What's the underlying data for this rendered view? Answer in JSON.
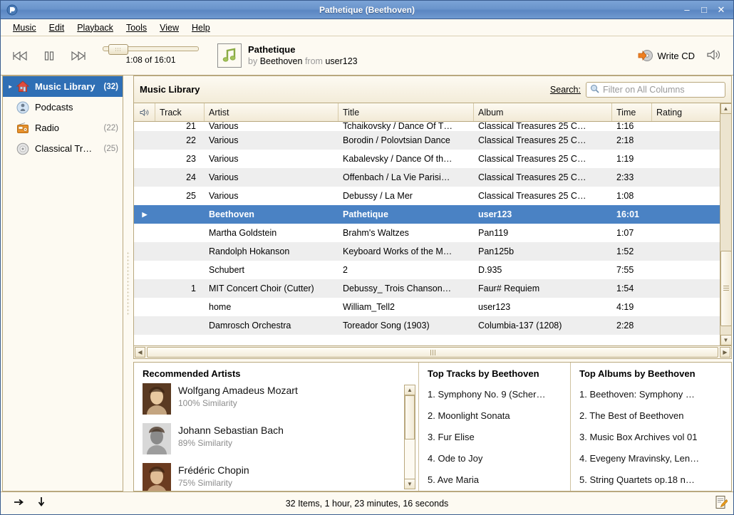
{
  "window": {
    "title": "Pathetique (Beethoven)",
    "app_icon": "rhythmbox-icon",
    "buttons": {
      "minimize": "–",
      "maximize": "□",
      "close": "✕"
    }
  },
  "menubar": {
    "items": [
      {
        "label": "Music",
        "mnemonic": "M"
      },
      {
        "label": "Edit",
        "mnemonic": "E"
      },
      {
        "label": "Playback",
        "mnemonic": "P"
      },
      {
        "label": "Tools",
        "mnemonic": "T"
      },
      {
        "label": "View",
        "mnemonic": "V"
      },
      {
        "label": "Help",
        "mnemonic": "H"
      }
    ]
  },
  "toolbar": {
    "previous_label": "Previous",
    "pause_label": "Pause",
    "next_label": "Next",
    "seek_time": "1:08 of 16:01",
    "seek_position_percent": 7,
    "now_playing": {
      "title": "Pathetique",
      "by_word": "by",
      "artist": "Beethoven",
      "from_word": "from",
      "album": "user123"
    },
    "write_cd_label": "Write CD",
    "volume_label": "Volume"
  },
  "sidebar": {
    "items": [
      {
        "label": "Music Library",
        "count": "(32)",
        "icon": "home-icon",
        "selected": true,
        "expander": "▸"
      },
      {
        "label": "Podcasts",
        "count": "",
        "icon": "podcast-icon",
        "selected": false,
        "expander": ""
      },
      {
        "label": "Radio",
        "count": "(22)",
        "icon": "radio-icon",
        "selected": false,
        "expander": ""
      },
      {
        "label": "Classical Tr…",
        "count": "(25)",
        "icon": "cd-icon",
        "selected": false,
        "expander": ""
      }
    ]
  },
  "library": {
    "header_title": "Music Library",
    "search": {
      "label": "Search:",
      "mnemonic": "S",
      "value": "",
      "placeholder": "Filter on All Columns",
      "icon": "search-icon"
    },
    "columns": [
      {
        "key": "play",
        "label": "",
        "icon": "speaker-icon"
      },
      {
        "key": "track",
        "label": "Track"
      },
      {
        "key": "artist",
        "label": "Artist"
      },
      {
        "key": "title",
        "label": "Title"
      },
      {
        "key": "album",
        "label": "Album"
      },
      {
        "key": "time",
        "label": "Time"
      },
      {
        "key": "rating",
        "label": "Rating"
      }
    ],
    "rows": [
      {
        "track": "21",
        "artist": "Various",
        "title": "Tchaikovsky / Dance Of T…",
        "album": "Classical Treasures 25 C…",
        "time": "1:16",
        "rating": "",
        "state": "clipped"
      },
      {
        "track": "22",
        "artist": "Various",
        "title": "Borodin / Polovtsian Dance",
        "album": "Classical Treasures 25 C…",
        "time": "2:18",
        "rating": "",
        "state": "alt"
      },
      {
        "track": "23",
        "artist": "Various",
        "title": "Kabalevsky / Dance Of th…",
        "album": "Classical Treasures 25 C…",
        "time": "1:19",
        "rating": "",
        "state": ""
      },
      {
        "track": "24",
        "artist": "Various",
        "title": "Offenbach / La Vie Parisi…",
        "album": "Classical Treasures 25 C…",
        "time": "2:33",
        "rating": "",
        "state": "alt"
      },
      {
        "track": "25",
        "artist": "Various",
        "title": "Debussy / La Mer",
        "album": "Classical Treasures 25 C…",
        "time": "1:08",
        "rating": "",
        "state": ""
      },
      {
        "track": "",
        "artist": "Beethoven",
        "title": "Pathetique",
        "album": "user123",
        "time": "16:01",
        "rating": "",
        "state": "selected",
        "playing_marker": "▶"
      },
      {
        "track": "",
        "artist": "Martha Goldstein",
        "title": "Brahm's Waltzes",
        "album": "Pan119",
        "time": "1:07",
        "rating": "",
        "state": ""
      },
      {
        "track": "",
        "artist": "Randolph Hokanson",
        "title": "Keyboard Works of the M…",
        "album": "Pan125b",
        "time": "1:52",
        "rating": "",
        "state": "alt"
      },
      {
        "track": "",
        "artist": "Schubert",
        "title": "2",
        "album": "D.935",
        "time": "7:55",
        "rating": "",
        "state": ""
      },
      {
        "track": "1",
        "artist": "MIT Concert Choir (Cutter)",
        "title": "Debussy_ Trois Chanson…",
        "album": "Faur# Requiem",
        "time": "1:54",
        "rating": "",
        "state": "alt"
      },
      {
        "track": "",
        "artist": "home",
        "title": "William_Tell2",
        "album": "user123",
        "time": "4:19",
        "rating": "",
        "state": ""
      },
      {
        "track": "",
        "artist": "Damrosch Orchestra",
        "title": "Toreador Song (1903)",
        "album": "Columbia-137 (1208)",
        "time": "2:28",
        "rating": "",
        "state": "alt"
      }
    ]
  },
  "recommended": {
    "title": "Recommended Artists",
    "artists": [
      {
        "name": "Wolfgang Amadeus Mozart",
        "similarity": "100% Similarity",
        "portrait": "mozart-portrait"
      },
      {
        "name": "Johann Sebastian Bach",
        "similarity": "89% Similarity",
        "portrait": "bach-portrait"
      },
      {
        "name": "Frédéric Chopin",
        "similarity": "75% Similarity",
        "portrait": "chopin-portrait"
      }
    ]
  },
  "top_tracks": {
    "title": "Top Tracks by Beethoven",
    "items": [
      "1. Symphony No. 9 (Scher…",
      "2. Moonlight Sonata",
      "3. Fur Elise",
      "4. Ode to Joy",
      "5. Ave Maria"
    ]
  },
  "top_albums": {
    "title": "Top Albums by Beethoven",
    "items": [
      "1. Beethoven: Symphony …",
      "2. The Best of Beethoven",
      "3. Music Box Archives vol 01",
      "4. Evegeny Mravinsky, Len…",
      "5. String Quartets op.18 n…"
    ]
  },
  "statusbar": {
    "shuffle_icon": "arrow-right-icon",
    "repeat_icon": "arrow-down-icon",
    "text": "32 Items, 1 hour, 23 minutes, 16 seconds",
    "edit_icon": "edit-note-icon"
  },
  "colors": {
    "titlebar_blue": "#6b95cc",
    "selection_blue": "#4a82c4",
    "sidebar_selection": "#2f6fb5",
    "panel_cream": "#fdfaf2",
    "border_tan": "#b9a87e",
    "alt_row": "#eeeeee"
  }
}
